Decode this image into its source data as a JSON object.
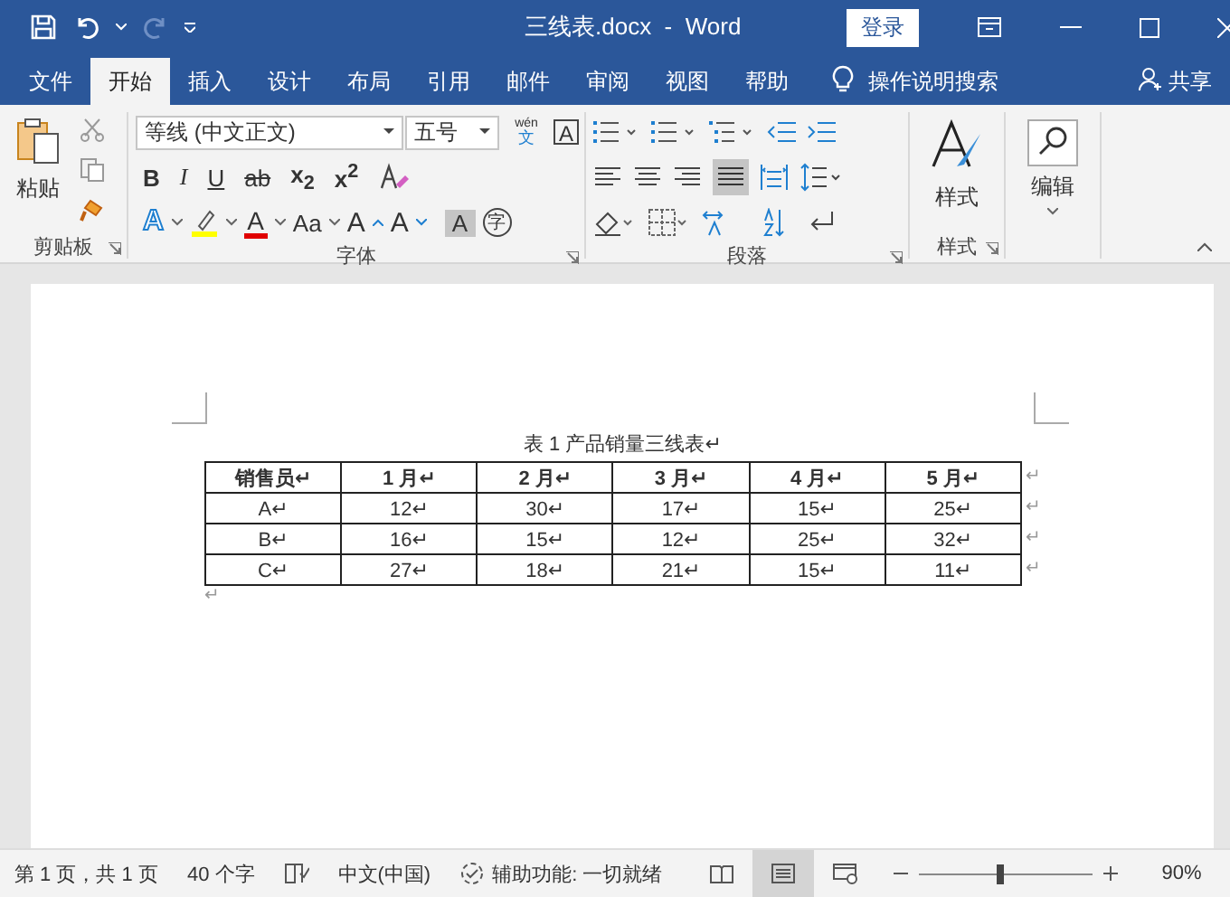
{
  "window": {
    "title": "三线表.docx  -  Word",
    "login": "登录"
  },
  "tabs": [
    {
      "label": "文件",
      "selected": false
    },
    {
      "label": "开始",
      "selected": true
    },
    {
      "label": "插入",
      "selected": false
    },
    {
      "label": "设计",
      "selected": false
    },
    {
      "label": "布局",
      "selected": false
    },
    {
      "label": "引用",
      "selected": false
    },
    {
      "label": "邮件",
      "selected": false
    },
    {
      "label": "审阅",
      "selected": false
    },
    {
      "label": "视图",
      "selected": false
    },
    {
      "label": "帮助",
      "selected": false
    }
  ],
  "tell_me": "操作说明搜索",
  "share": "共享",
  "clipboard": {
    "label": "剪贴板",
    "paste": "粘贴"
  },
  "font": {
    "label": "字体",
    "font_name": "等线 (中文正文)",
    "font_size": "五号",
    "phonetic_top": "wén",
    "phonetic_bottom": "文",
    "char_border": "A",
    "row2": [
      "B",
      "I",
      "U",
      "ab",
      "x$_{2}$",
      "x$^{2}$"
    ],
    "effects": "A",
    "font_color": "A",
    "change_case": "Aa",
    "grow": "A",
    "shrink": "A",
    "shading": "A",
    "enclose": "字"
  },
  "paragraph": {
    "label": "段落"
  },
  "styles": {
    "label": "样式",
    "button": "样式"
  },
  "editing": {
    "button": "编辑"
  },
  "document": {
    "caption": "表 1 产品销量三线表↵",
    "columns": [
      "销售员↵",
      "1 月↵",
      "2 月↵",
      "3 月↵",
      "4 月↵",
      "5 月↵"
    ],
    "rows": [
      [
        "A↵",
        "12↵",
        "30↵",
        "17↵",
        "15↵",
        "25↵"
      ],
      [
        "B↵",
        "16↵",
        "15↵",
        "12↵",
        "25↵",
        "32↵"
      ],
      [
        "C↵",
        "27↵",
        "18↵",
        "21↵",
        "15↵",
        "11↵"
      ]
    ],
    "row_end": "↵",
    "after_table": "↵"
  },
  "status_bar": {
    "page": "第 1 页，共 1 页",
    "words": "40 个字",
    "language": "中文(中国)",
    "accessibility": "辅助功能: 一切就绪",
    "views": [
      {
        "selected": false
      },
      {
        "selected": true
      },
      {
        "selected": false
      }
    ],
    "zoom": {
      "level": 0.47,
      "reading": "90%"
    }
  }
}
